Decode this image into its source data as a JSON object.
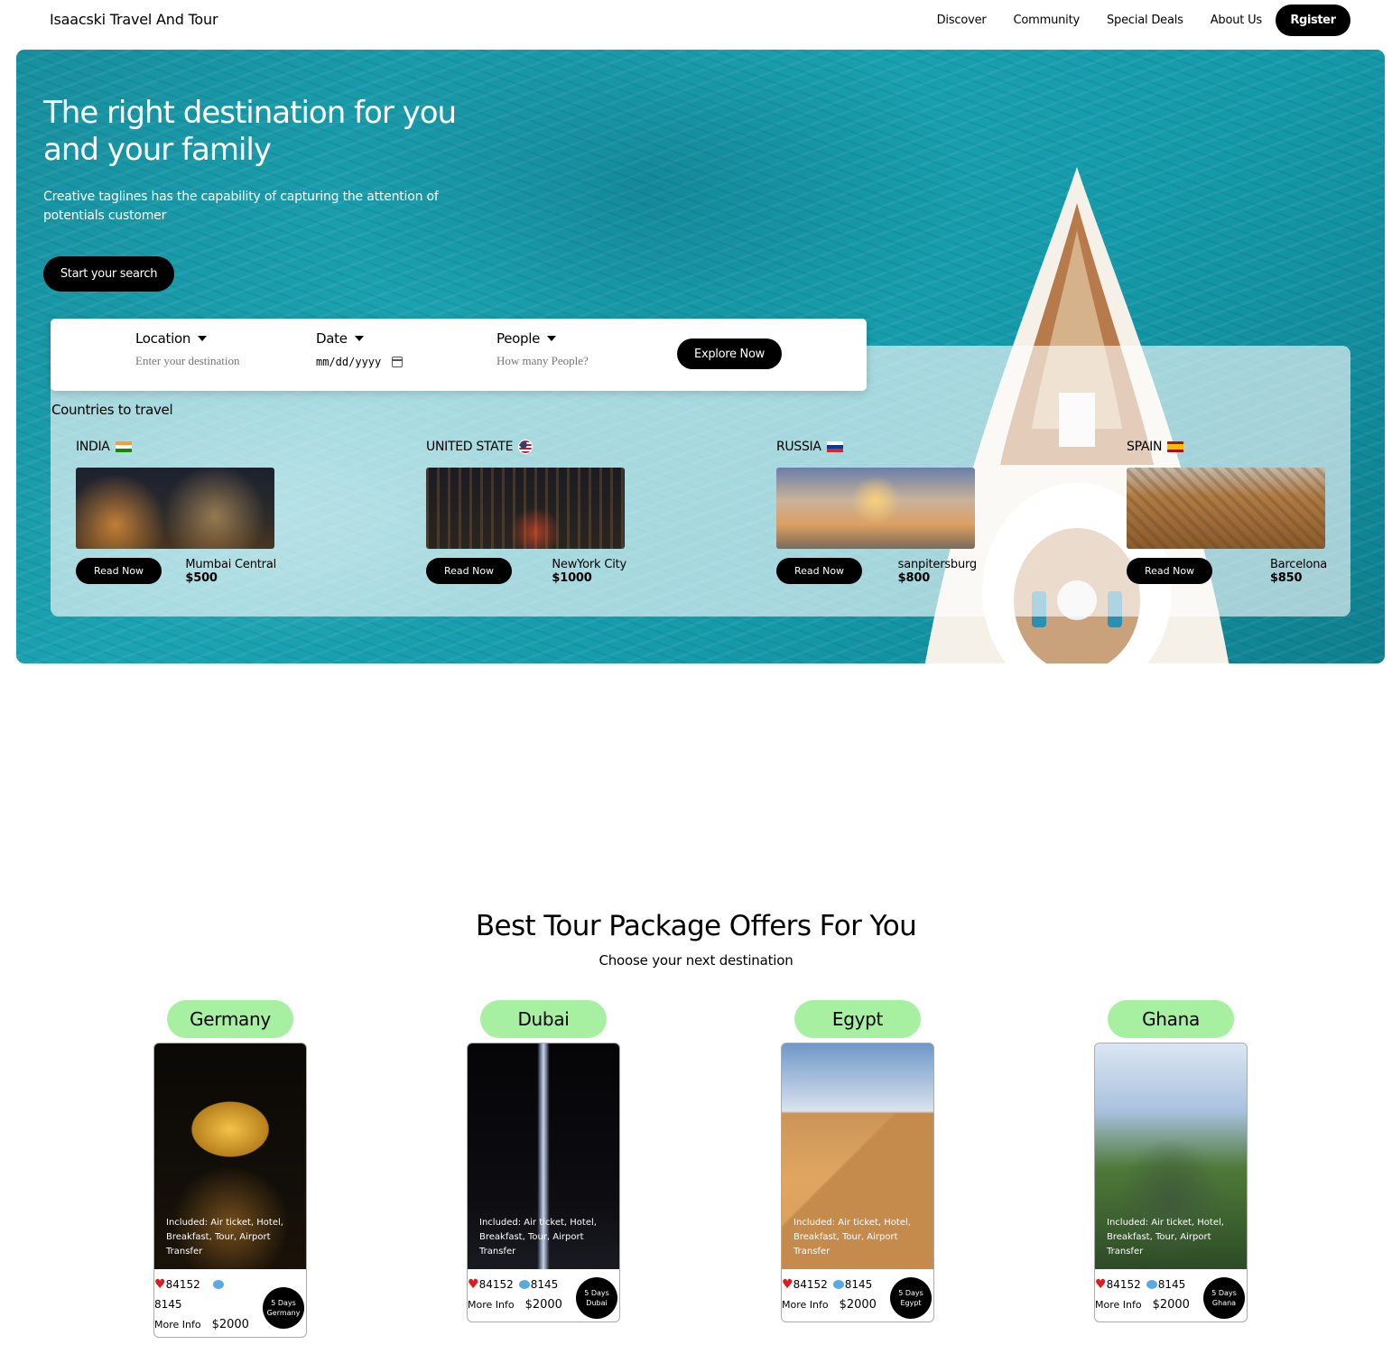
{
  "nav": {
    "brand": "Isaacski Travel And Tour",
    "links": [
      "Discover",
      "Community",
      "Special Deals",
      "About Us"
    ],
    "register_label": "Rgister"
  },
  "hero": {
    "title": "The right destination for you and your family",
    "tagline": "Creative taglines has the capability of capturing the attention of potentials customer",
    "start_label": "Start your search"
  },
  "search": {
    "location_label": "Location",
    "location_placeholder": "Enter your destination",
    "date_label": "Date",
    "date_placeholder": "mm/dd/yyyy",
    "people_label": "People",
    "people_placeholder": "How many People?",
    "explore_label": "Explore Now"
  },
  "countries": {
    "title": "Countries to travel",
    "items": [
      {
        "name": "INDIA",
        "city": "Mumbai Central",
        "price": "$500",
        "button": "Read Now"
      },
      {
        "name": "UNITED STATE",
        "city": "NewYork City",
        "price": "$1000",
        "button": "Read Now"
      },
      {
        "name": "RUSSIA",
        "city": "sanpitersburg",
        "price": "$800",
        "button": "Read Now"
      },
      {
        "name": "SPAIN",
        "city": "Barcelona",
        "price": "$850",
        "button": "Read Now"
      }
    ]
  },
  "packages": {
    "title": "Best Tour Package Offers For You",
    "subtitle": "Choose your next destination",
    "items": [
      {
        "name": "Germany",
        "included": "Included: Air ticket, Hotel, Breakfast, Tour, Airport Transfer",
        "likes": "84152",
        "comments": "8145",
        "more": "More Info",
        "price": "$2000",
        "days": "5 Days",
        "badge_place": "Germany"
      },
      {
        "name": "Dubai",
        "included": "Included: Air ticket, Hotel, Breakfast, Tour, Airport Transfer",
        "likes": "84152",
        "comments": "8145",
        "more": "More Info",
        "price": "$2000",
        "days": "5 Days",
        "badge_place": "Dubai"
      },
      {
        "name": "Egypt",
        "included": "Included: Air ticket, Hotel, Breakfast, Tour, Airport Transfer",
        "likes": "84152",
        "comments": "8145",
        "more": "More Info",
        "price": "$2000",
        "days": "5 Days",
        "badge_place": "Egypt"
      },
      {
        "name": "Ghana",
        "included": "Included: Air ticket, Hotel, Breakfast, Tour, Airport Transfer",
        "likes": "84152",
        "comments": "8145",
        "more": "More Info",
        "price": "$2000",
        "days": "5 Days",
        "badge_place": "Ghana"
      }
    ]
  }
}
